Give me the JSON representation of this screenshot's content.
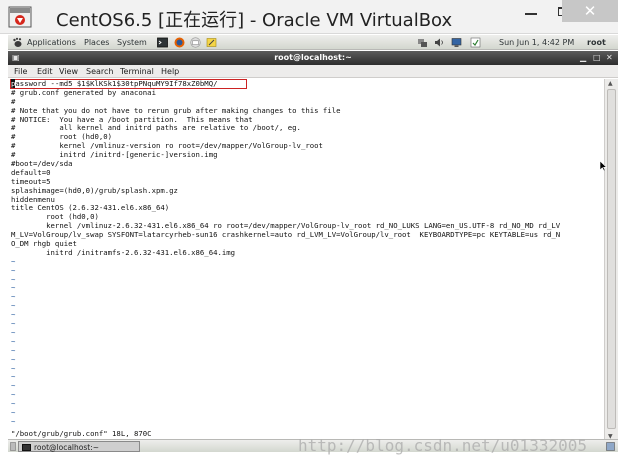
{
  "vbox": {
    "title": "CentOS6.5 [正在运行] - Oracle VM VirtualBox",
    "close_label": "✕"
  },
  "panel": {
    "applications": "Applications",
    "places": "Places",
    "system": "System",
    "clock": "Sun Jun  1,  4:42 PM",
    "user": "root"
  },
  "terminal": {
    "window_title": "root@localhost:~",
    "menu": [
      "File",
      "Edit",
      "View",
      "Search",
      "Terminal",
      "Help"
    ],
    "lines": [
      "password --md5 $1$KlKSk1$30tpPNquMY9If78xZ0bMQ/",
      "# grub.conf generated by anaconai",
      "#",
      "# Note that you do not have to rerun grub after making changes to this file",
      "# NOTICE:  You have a /boot partition.  This means that",
      "#          all kernel and initrd paths are relative to /boot/, eg.",
      "#          root (hd0,0)",
      "#          kernel /vmlinuz-version ro root=/dev/mapper/VolGroup-lv_root",
      "#          initrd /initrd-[generic-]version.img",
      "#boot=/dev/sda",
      "default=0",
      "timeout=5",
      "splashimage=(hd0,0)/grub/splash.xpm.gz",
      "hiddenmenu",
      "title CentOS (2.6.32-431.el6.x86_64)",
      "        root (hd0,0)",
      "        kernel /vmlinuz-2.6.32-431.el6.x86_64 ro root=/dev/mapper/VolGroup-lv_root rd_NO_LUKS LANG=en_US.UTF-8 rd_NO_MD rd_LV",
      "M_LV=VolGroup/lv_swap SYSFONT=latarcyrheb-sun16 crashkernel=auto rd_LVM_LV=VolGroup/lv_root  KEYBOARDTYPE=pc KEYTABLE=us rd_N",
      "O_DM rhgb quiet",
      "        initrd /initramfs-2.6.32-431.el6.x86_64.img"
    ],
    "tilde_count": 19,
    "tilde": "~",
    "status_line": "\"/boot/grub/grub.conf\" 18L, 870C"
  },
  "taskbar": {
    "item_label": "root@localhost:~"
  },
  "watermark": "http://blog.csdn.net/u01332005"
}
